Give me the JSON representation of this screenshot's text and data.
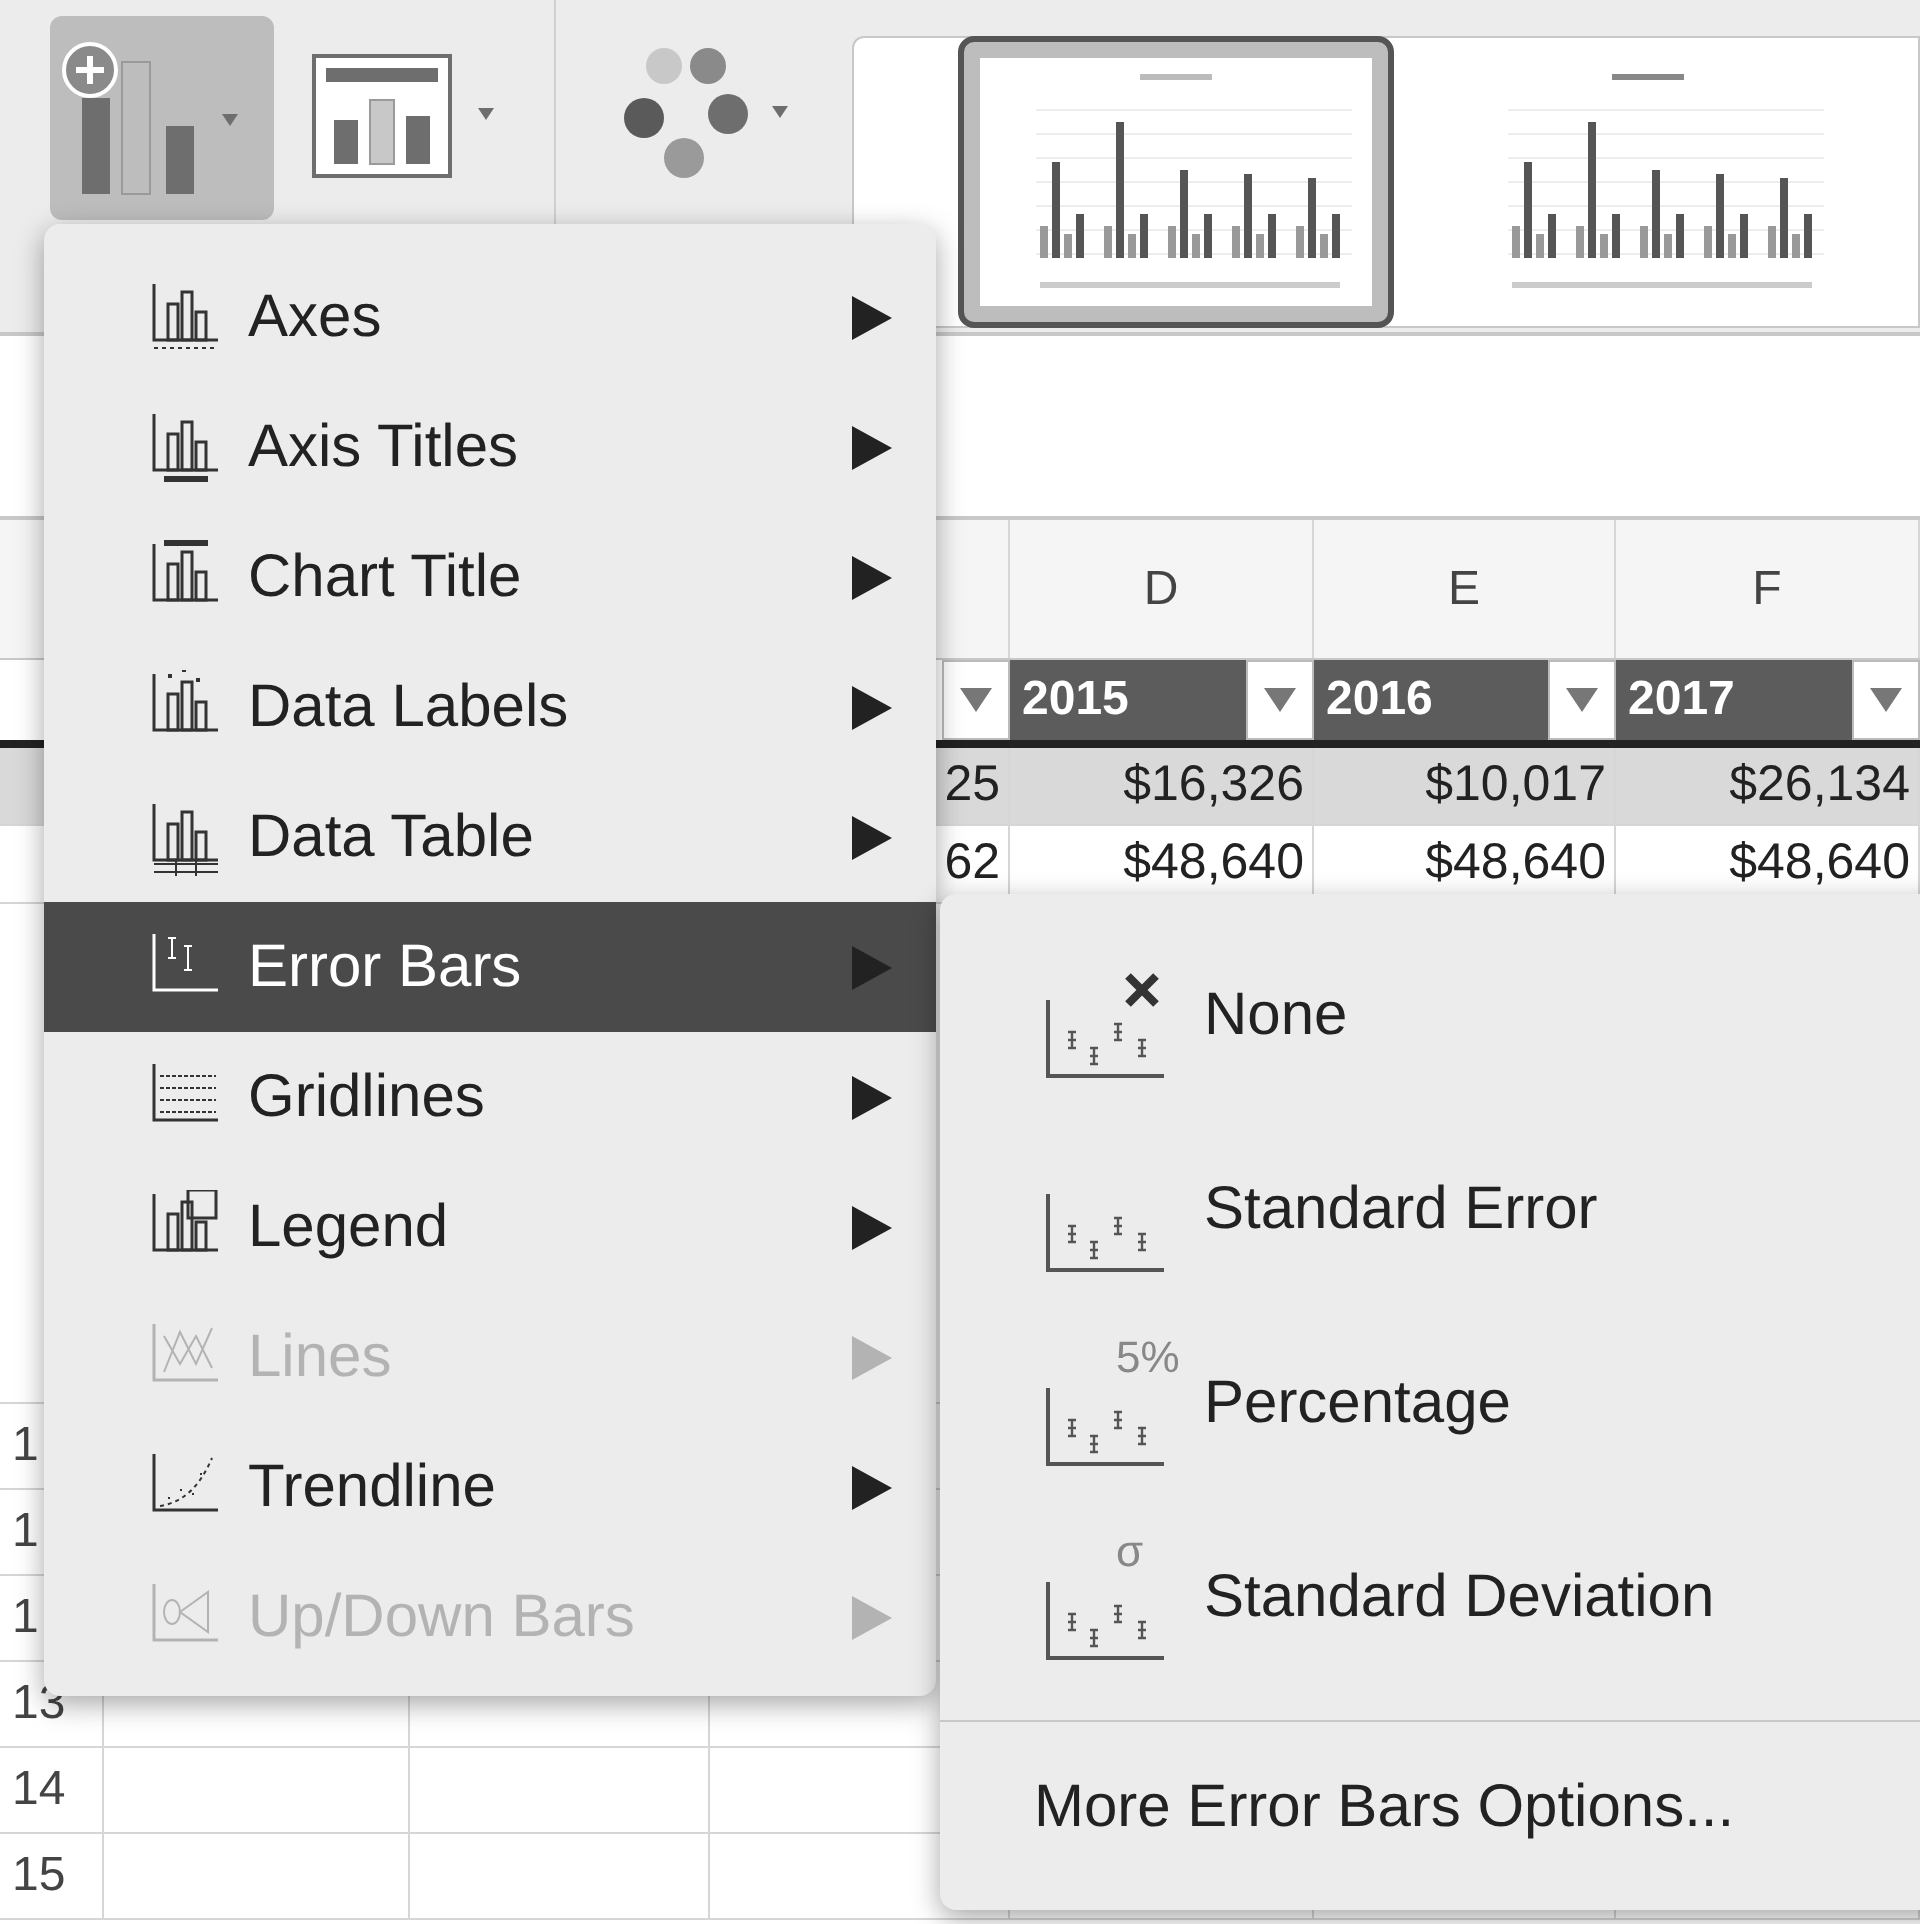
{
  "ribbon": {
    "tools": [
      {
        "kind": "add_chart_element",
        "selected": true
      },
      {
        "kind": "quick_layout",
        "selected": false
      },
      {
        "kind": "change_colors",
        "selected": false
      }
    ],
    "chart_styles": [
      {
        "selected": true
      },
      {
        "selected": false
      }
    ]
  },
  "sheet": {
    "column_headers": [
      "D",
      "E",
      "F"
    ],
    "table_headers": [
      "2015",
      "2016",
      "2017"
    ],
    "rows": [
      {
        "shaded": true,
        "cells": [
          "25",
          "$16,326",
          "$10,017",
          "$26,134"
        ]
      },
      {
        "shaded": false,
        "cells": [
          "62",
          "$48,640",
          "$48,640",
          "$48,640"
        ]
      }
    ],
    "row_numbers": [
      "1",
      "1",
      "1",
      "13",
      "14",
      "15"
    ]
  },
  "menu": {
    "items": [
      {
        "label": "Axes",
        "selected": false,
        "disabled": false
      },
      {
        "label": "Axis Titles",
        "selected": false,
        "disabled": false
      },
      {
        "label": "Chart Title",
        "selected": false,
        "disabled": false
      },
      {
        "label": "Data Labels",
        "selected": false,
        "disabled": false
      },
      {
        "label": "Data Table",
        "selected": false,
        "disabled": false
      },
      {
        "label": "Error Bars",
        "selected": true,
        "disabled": false
      },
      {
        "label": "Gridlines",
        "selected": false,
        "disabled": false
      },
      {
        "label": "Legend",
        "selected": false,
        "disabled": false
      },
      {
        "label": "Lines",
        "selected": false,
        "disabled": true
      },
      {
        "label": "Trendline",
        "selected": false,
        "disabled": false
      },
      {
        "label": "Up/Down Bars",
        "selected": false,
        "disabled": true
      }
    ]
  },
  "submenu": {
    "items": [
      {
        "kind": "none",
        "label": "None"
      },
      {
        "kind": "plain",
        "label": "Standard Error"
      },
      {
        "kind": "badge",
        "badge": "5%",
        "label": "Percentage"
      },
      {
        "kind": "badge",
        "badge": "σ",
        "label": "Standard Deviation"
      }
    ],
    "footer": "More Error Bars Options..."
  }
}
